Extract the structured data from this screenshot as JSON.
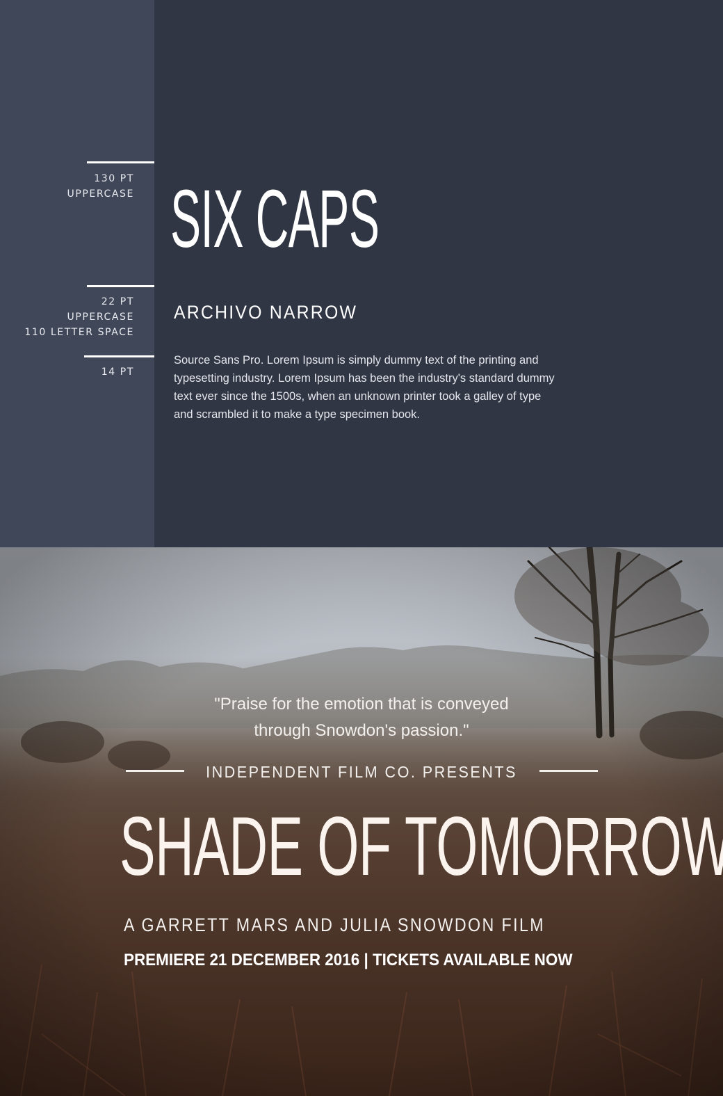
{
  "specimen": {
    "annotations": [
      {
        "lines": [
          "130 PT",
          "UPPERCASE"
        ]
      },
      {
        "lines": [
          "22 PT",
          "UPPERCASE",
          "110 LETTER SPACE"
        ]
      },
      {
        "lines": [
          "14 PT"
        ]
      }
    ],
    "display_sample": "SIX CAPS",
    "sub_sample": "ARCHIVO NARROW",
    "body_sample": "Source Sans Pro. Lorem Ipsum is simply dummy text of the printing and typesetting industry. Lorem Ipsum has been the industry's standard dummy text ever since the 1500s, when an unknown printer took a galley of type and scrambled it to make a type specimen book."
  },
  "poster": {
    "quote_line_1": "\"Praise for the emotion that is conveyed",
    "quote_line_2": "through Snowdon's passion.\"",
    "presents": "INDEPENDENT FILM CO. PRESENTS",
    "title": "SHADE OF TOMORROW",
    "byline": "A GARRETT MARS AND JULIA SNOWDON FILM",
    "premiere": "PREMIERE 21 DECEMBER 2016 | TICKETS AVAILABLE NOW",
    "background": "misty heathland landscape with bare birch tree"
  },
  "colors": {
    "panel": "#313644",
    "sidebar": "#404759",
    "text": "#ffffff"
  }
}
